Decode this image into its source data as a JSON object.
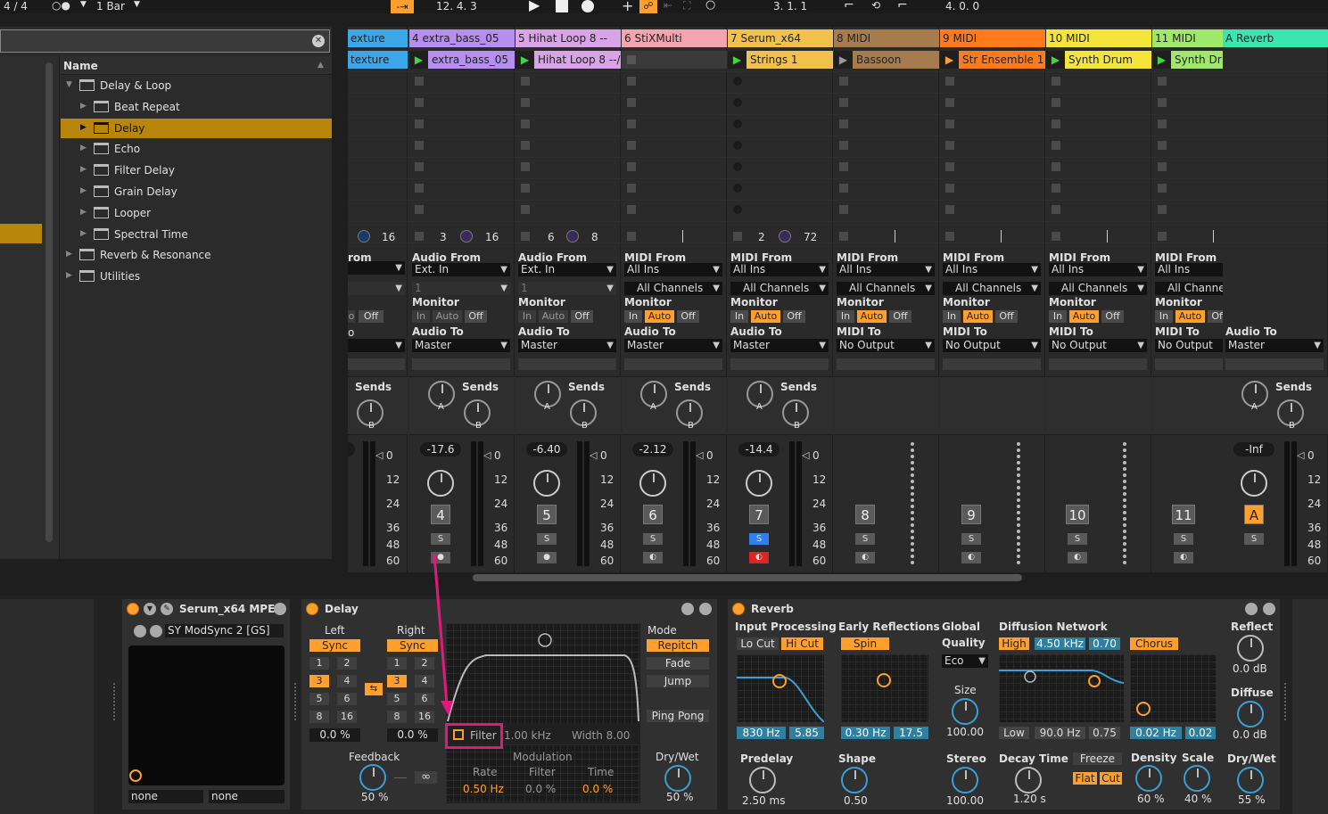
{
  "toolbar": {
    "time_sig": "4 / 4",
    "quant": "1 Bar",
    "arrangement_pos": "12.  4.  3",
    "loop_start": "3.  1.  1",
    "loop_length": "4.  0.  0"
  },
  "browser": {
    "header": "Name",
    "items": [
      {
        "label": "Delay & Loop",
        "expanded": true
      },
      {
        "label": "Beat Repeat"
      },
      {
        "label": "Delay",
        "selected": true
      },
      {
        "label": "Echo"
      },
      {
        "label": "Filter Delay"
      },
      {
        "label": "Grain Delay"
      },
      {
        "label": "Looper"
      },
      {
        "label": "Spectral Time"
      },
      {
        "label": "Reverb & Resonance"
      },
      {
        "label": "Utilities"
      }
    ]
  },
  "tracks": [
    {
      "title": "exture",
      "clip": "texture",
      "color": "#3aa7e8",
      "num": "",
      "vol": "",
      "send_a": "16"
    },
    {
      "title": "4 extra_bass_05",
      "clip": "extra_bass_05",
      "color": "#b68ef0",
      "num": "4",
      "vol": "-17.6",
      "send_a": "3",
      "send_b": "16"
    },
    {
      "title": "5 Hihat Loop 8 --",
      "clip": "Hihat Loop 8 --/",
      "color": "#d9a3e8",
      "num": "5",
      "vol": "-6.40",
      "send_a": "6",
      "send_b": "8"
    },
    {
      "title": "6 StiXMulti",
      "clip": "",
      "color": "#f4a3b0",
      "num": "6",
      "vol": "-2.12"
    },
    {
      "title": "7 Serum_x64",
      "clip": "Strings 1",
      "color": "#f2c14b",
      "num": "7",
      "vol": "-14.4",
      "send_a": "2",
      "send_b": "72"
    },
    {
      "title": "8 MIDI",
      "clip": "Bassoon",
      "color": "#a67c4e",
      "num": "8"
    },
    {
      "title": "9 MIDI",
      "clip": "Str Ensemble 1",
      "color": "#ff7a1a",
      "num": "9"
    },
    {
      "title": "10 MIDI",
      "clip": "Synth Drum",
      "color": "#f5e53b",
      "num": "10"
    },
    {
      "title": "11 MIDI",
      "clip": "Synth Dr",
      "color": "#9fe86a",
      "num": "11"
    },
    {
      "title": "A Reverb",
      "clip": "",
      "color": "#39e6b0",
      "num": "A",
      "vol": "-Inf"
    }
  ],
  "io": {
    "audio_from": "Audio From",
    "midi_from": "MIDI From",
    "ext_in": "Ext. In",
    "all_ins": "All Ins",
    "one": "1",
    "all_channels": "All Channels",
    "monitor": "Monitor",
    "in": "In",
    "auto": "Auto",
    "off": "Off",
    "audio_to": "Audio To",
    "midi_to": "MIDI To",
    "master": "Master",
    "no_output": "No Output",
    "sends": "Sends",
    "a": "A",
    "b": "B",
    "s": "S",
    "rom": "rom",
    "o": "o",
    "all_channe": "All Channe"
  },
  "meter_scale": [
    "0",
    "12",
    "24",
    "36",
    "48",
    "60"
  ],
  "serum": {
    "title": "Serum_x64 MPE",
    "preset": "SY ModSync 2 [GS]",
    "none1": "none",
    "none2": "none"
  },
  "delay": {
    "title": "Delay",
    "left": "Left",
    "right": "Right",
    "sync": "Sync",
    "nums": [
      "1",
      "2",
      "3",
      "4",
      "5",
      "6",
      "8",
      "16"
    ],
    "left_pct": "0.0 %",
    "right_pct": "0.0 %",
    "filter": "Filter",
    "filter_freq": "1.00 kHz",
    "width": "Width 8.00",
    "modulation": "Modulation",
    "rate": "Rate",
    "filter_lbl": "Filter",
    "time": "Time",
    "rate_val": "0.50 Hz",
    "filter_val": "0.0 %",
    "time_val": "0.0 %",
    "feedback": "Feedback",
    "feedback_val": "50 %",
    "mode": "Mode",
    "repitch": "Repitch",
    "fade": "Fade",
    "jump": "Jump",
    "ping_pong": "Ping Pong",
    "drywet": "Dry/Wet",
    "drywet_val": "50 %",
    "infinity": "∞"
  },
  "reverb": {
    "title": "Reverb",
    "input_processing": "Input Processing",
    "lo_cut": "Lo Cut",
    "hi_cut": "Hi Cut",
    "in_freq": "830 Hz",
    "in_q": "5.85",
    "early": "Early Reflections",
    "spin": "Spin",
    "er_freq": "0.30 Hz",
    "er_amt": "17.5",
    "global": "Global",
    "quality": "Quality",
    "eco": "Eco",
    "size": "Size",
    "size_val": "100.00",
    "diffusion": "Diffusion Network",
    "high": "High",
    "high_freq": "4.50 kHz",
    "high_val": "0.70",
    "chorus": "Chorus",
    "low": "Low",
    "low_freq": "90.0 Hz",
    "low_val": "0.75",
    "chorus_rate": "0.02 Hz",
    "chorus_amt": "0.02",
    "reflect": "Reflect",
    "reflect_val": "0.0 dB",
    "diffuse": "Diffuse",
    "diffuse_val": "0.0 dB",
    "predelay": "Predelay",
    "predelay_val": "2.50 ms",
    "shape": "Shape",
    "shape_val": "0.50",
    "stereo": "Stereo",
    "stereo_val": "100.00",
    "decay": "Decay Time",
    "decay_val": "1.20 s",
    "freeze": "Freeze",
    "flat": "Flat",
    "cut": "Cut",
    "density": "Density",
    "density_val": "60 %",
    "scale": "Scale",
    "scale_val": "40 %",
    "drywet": "Dry/Wet",
    "drywet_val": "55 %"
  },
  "colors": {
    "accent": "#ff9f2e",
    "highlight": "#e0197d",
    "selected_row": "#b8860b"
  }
}
